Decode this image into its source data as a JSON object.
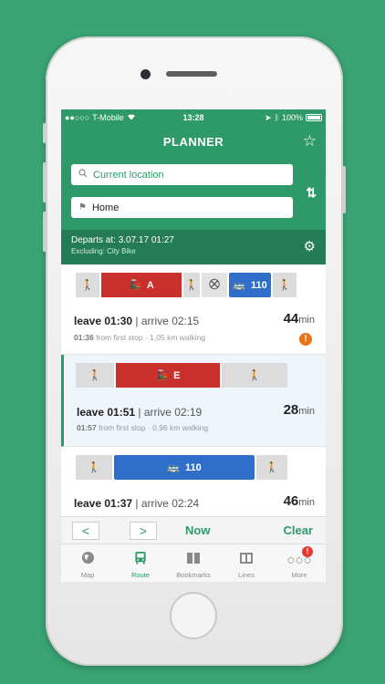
{
  "status": {
    "carrier": "T-Mobile",
    "time": "13:28",
    "battery": "100%"
  },
  "header": {
    "title": "PLANNER"
  },
  "search": {
    "from_value": "Current location",
    "to_value": "Home"
  },
  "departs": {
    "line1": "Departs at: 3.07.17 01:27",
    "line2": "Excluding: City Bike"
  },
  "trips": [
    {
      "legs": [
        {
          "type": "walk"
        },
        {
          "type": "train",
          "label": "A"
        },
        {
          "type": "walk"
        },
        {
          "type": "other"
        },
        {
          "type": "bus",
          "label": "110"
        },
        {
          "type": "walk"
        }
      ],
      "leave": "leave 01:30",
      "arrive": "| arrive 02:15",
      "sub_time": "01:36",
      "sub_text": "from first stop · 1,05 km walking",
      "duration_num": "44",
      "duration_unit": "min",
      "warning": "!"
    },
    {
      "legs": [
        {
          "type": "walk"
        },
        {
          "type": "train",
          "label": "E"
        },
        {
          "type": "walk"
        }
      ],
      "leave": "leave 01:51",
      "arrive": "| arrive 02:19",
      "sub_time": "01:57",
      "sub_text": "from first stop · 0,96 km walking",
      "duration_num": "28",
      "duration_unit": "min"
    },
    {
      "legs": [
        {
          "type": "walk"
        },
        {
          "type": "bus",
          "label": "110"
        },
        {
          "type": "walk"
        }
      ],
      "leave": "leave 01:37",
      "arrive": "| arrive 02:24",
      "duration_num": "46",
      "duration_unit": "min"
    }
  ],
  "bottom_bar": {
    "prev": "<",
    "next": ">",
    "now": "Now",
    "clear": "Clear"
  },
  "tabs": [
    {
      "label": "Map",
      "icon": "globe-icon"
    },
    {
      "label": "Route",
      "icon": "bus-icon"
    },
    {
      "label": "Bookmarks",
      "icon": "book-icon"
    },
    {
      "label": "Lines",
      "icon": "lines-icon"
    },
    {
      "label": "More",
      "icon": "more-icon",
      "badge": "!"
    }
  ],
  "colors": {
    "background": "#3aa474",
    "header": "#2f9a69",
    "departs_bar": "#237c55",
    "train": "#c9302c",
    "bus": "#2f6fc9",
    "warning": "#e8731a"
  }
}
